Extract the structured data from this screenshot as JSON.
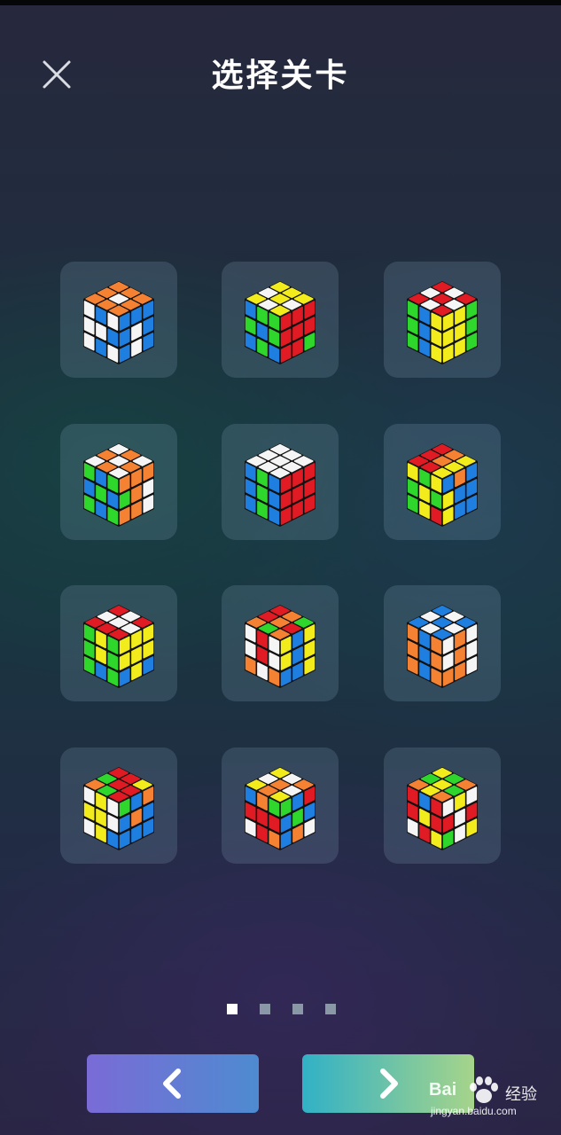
{
  "header": {
    "title": "选择关卡",
    "close_icon": "close-icon"
  },
  "colors": {
    "W": "#f5f5f5",
    "Y": "#f2ec1c",
    "R": "#e01b24",
    "O": "#f58233",
    "B": "#1f7fe0",
    "G": "#2fd62b",
    "body": "#111111",
    "card_bg": "rgba(130,165,185,0.22)",
    "prev_gradient": [
      "#7a6bd6",
      "#4e8bd0"
    ],
    "next_gradient": [
      "#31b1c6",
      "#a6d48a"
    ]
  },
  "levels": [
    {
      "top": "OOOOWOOOO",
      "left": "WBWWWBWBW",
      "right": "BBBBWBBWB"
    },
    {
      "top": "YYYWYWYWY",
      "left": "BGGGBGBGB",
      "right": "RRRRRRRRG"
    },
    {
      "top": "RWRWRWRWR",
      "left": "GBYGBYGBY",
      "right": "YYGYYGYYG"
    },
    {
      "top": "WOWOWOWOW",
      "left": "GBGBGBGBG",
      "right": "OOOGOWOOW"
    },
    {
      "top": "WWWWWWWWW",
      "left": "BGBBGBBGB",
      "right": "RRRRRRRRR"
    },
    {
      "top": "ROYROYRRY",
      "left": "YGYGYGGYR",
      "right": "BOBYBBYBB"
    },
    {
      "top": "RWRWWWRRR",
      "left": "GYGGYGGBG",
      "right": "YYYYYYBYB"
    },
    {
      "top": "ROGROROGO",
      "left": "WRWWRWOWO",
      "right": "YBYYBYBBY"
    },
    {
      "top": "BWBWBWBWB",
      "left": "OBOOBOOBO",
      "right": "WOWWOWOOW"
    },
    {
      "top": "RRYGRROGR",
      "left": "WYWYYWWYB",
      "right": "GBOBOBBBB"
    },
    {
      "top": "YWOWOWYOY",
      "left": "BOGRRRWRO",
      "right": "GBRBGBBOW"
    },
    {
      "top": "YGOGYGOYO",
      "left": "RBRRYRWRY",
      "right": "WYWRWRGWY"
    }
  ],
  "pager": {
    "count": 4,
    "active": 0
  },
  "nav": {
    "prev_icon": "chevron-left-icon",
    "next_icon": "chevron-right-icon"
  },
  "watermark": {
    "brand": "Bai",
    "brand_cn": "经验",
    "url": "jingyan.baidu.com"
  }
}
